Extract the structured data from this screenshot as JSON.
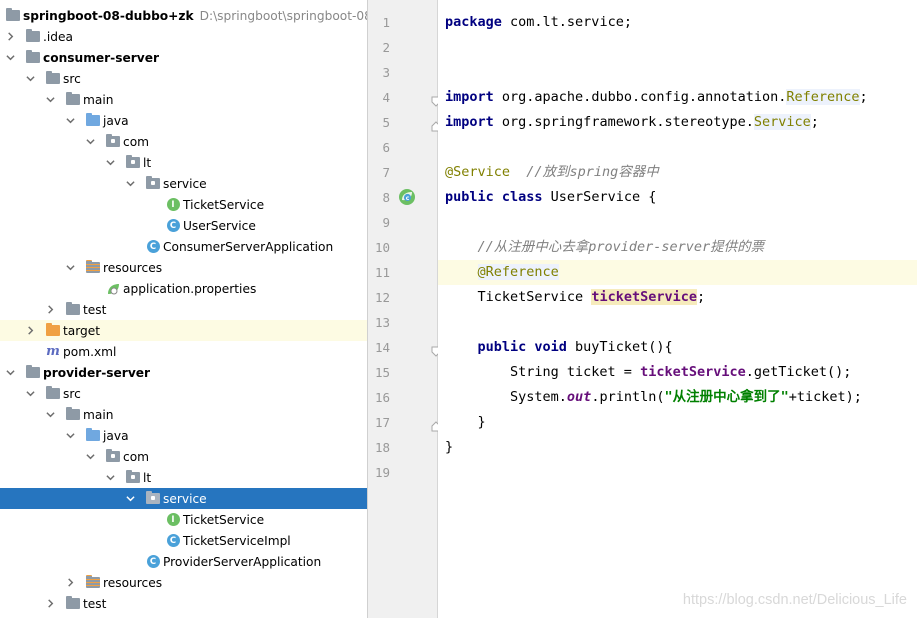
{
  "tree": {
    "root": {
      "name": "springboot-08-dubbo+zk",
      "path": "D:\\springboot\\springboot-08-d"
    },
    "items": [
      {
        "label": ".idea"
      },
      {
        "label": "consumer-server"
      },
      {
        "label": "src"
      },
      {
        "label": "main"
      },
      {
        "label": "java"
      },
      {
        "label": "com"
      },
      {
        "label": "lt"
      },
      {
        "label": "service"
      },
      {
        "label": "TicketService",
        "badge": "I"
      },
      {
        "label": "UserService",
        "badge": "C"
      },
      {
        "label": "ConsumerServerApplication",
        "badge": "C"
      },
      {
        "label": "resources"
      },
      {
        "label": "application.properties"
      },
      {
        "label": "test"
      },
      {
        "label": "target"
      },
      {
        "label": "pom.xml",
        "badge": "m"
      },
      {
        "label": "provider-server"
      },
      {
        "label": "src"
      },
      {
        "label": "main"
      },
      {
        "label": "java"
      },
      {
        "label": "com"
      },
      {
        "label": "lt"
      },
      {
        "label": "service"
      },
      {
        "label": "TicketService",
        "badge": "I"
      },
      {
        "label": "TicketServiceImpl",
        "badge": "C"
      },
      {
        "label": "ProviderServerApplication",
        "badge": "C"
      },
      {
        "label": "resources"
      },
      {
        "label": "test"
      }
    ],
    "selected": "service"
  },
  "editor": {
    "line_numbers": [
      "1",
      "2",
      "3",
      "4",
      "5",
      "6",
      "7",
      "8",
      "9",
      "10",
      "11",
      "12",
      "13",
      "14",
      "15",
      "16",
      "17",
      "18",
      "19"
    ],
    "code": {
      "l1_kw": "package",
      "l1_rest": " com.lt.service;",
      "l4_kw": "import",
      "l4_mid": " org.apache.dubbo.config.annotation.",
      "l4_ref": "Reference",
      "l4_end": ";",
      "l5_kw": "import",
      "l5_mid": " org.springframework.stereotype.",
      "l5_svc": "Service",
      "l5_end": ";",
      "l7_an": "@Service",
      "l7_cm": "  //放到spring容器中",
      "l8_kw": "public class",
      "l8_rest": " UserService {",
      "l10_cm": "    //从注册中心去拿provider-server提供的票",
      "l11_indent": "    ",
      "l11_an": "@Reference",
      "l12_a": "    TicketService ",
      "l12_fd": "ticketService",
      "l12_end": ";",
      "l14_indent": "    ",
      "l14_kw": "public void",
      "l14_rest": " buyTicket(){",
      "l15_a": "        String ticket = ",
      "l15_fd": "ticketService",
      "l15_rest": ".getTicket();",
      "l16_a": "        System.",
      "l16_so": "out",
      "l16_b": ".println(",
      "l16_st": "\"从注册中心拿到了\"",
      "l16_c": "+ticket);",
      "l17": "    }",
      "l18": "}"
    },
    "current_line": "11",
    "watermark": "https://blog.csdn.net/Delicious_Life"
  }
}
